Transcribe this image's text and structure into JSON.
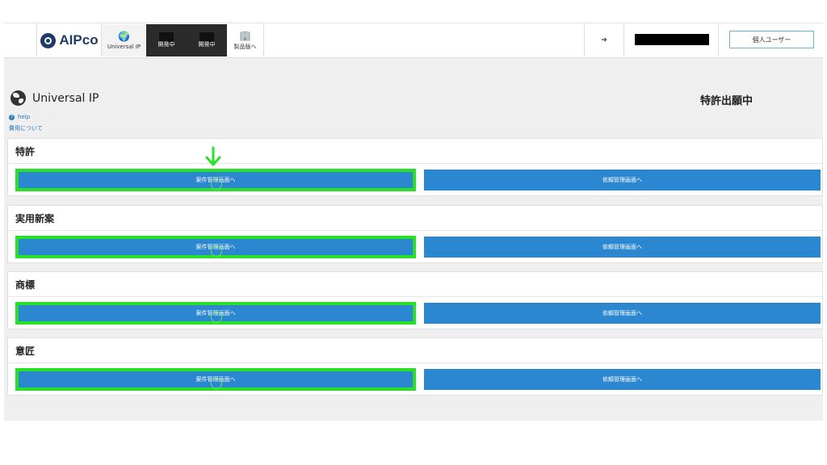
{
  "logo": {
    "text": "AIPco"
  },
  "nav": {
    "universal_ip": "Universal IP",
    "dev1": "開発中",
    "dev2": "開発中",
    "products": "製品版へ"
  },
  "user_button": "個人ユーザー",
  "page": {
    "title": "Universal IP",
    "status": "特許出願中",
    "help": "help",
    "fee_link": "費用について"
  },
  "sections": [
    {
      "title": "特許",
      "case_button": "案件管理画面へ",
      "request_button": "依頼管理画面へ"
    },
    {
      "title": "実用新案",
      "case_button": "案件管理画面へ",
      "request_button": "依頼管理画面へ"
    },
    {
      "title": "商標",
      "case_button": "案件管理画面へ",
      "request_button": "依頼管理画面へ"
    },
    {
      "title": "意匠",
      "case_button": "案件管理画面へ",
      "request_button": "依頼管理画面へ"
    }
  ],
  "colors": {
    "primary_button": "#2b87cf",
    "highlight": "#27e027",
    "nav_dark": "#2b2b2b",
    "brand": "#1f3b6a"
  },
  "icons": {
    "logo": "aipco-logo-icon",
    "universal_ip": "globe-icon",
    "products": "building-icon",
    "logout": "logout-icon",
    "help": "question-circle-icon",
    "annotation": "arrow-down-icon"
  }
}
